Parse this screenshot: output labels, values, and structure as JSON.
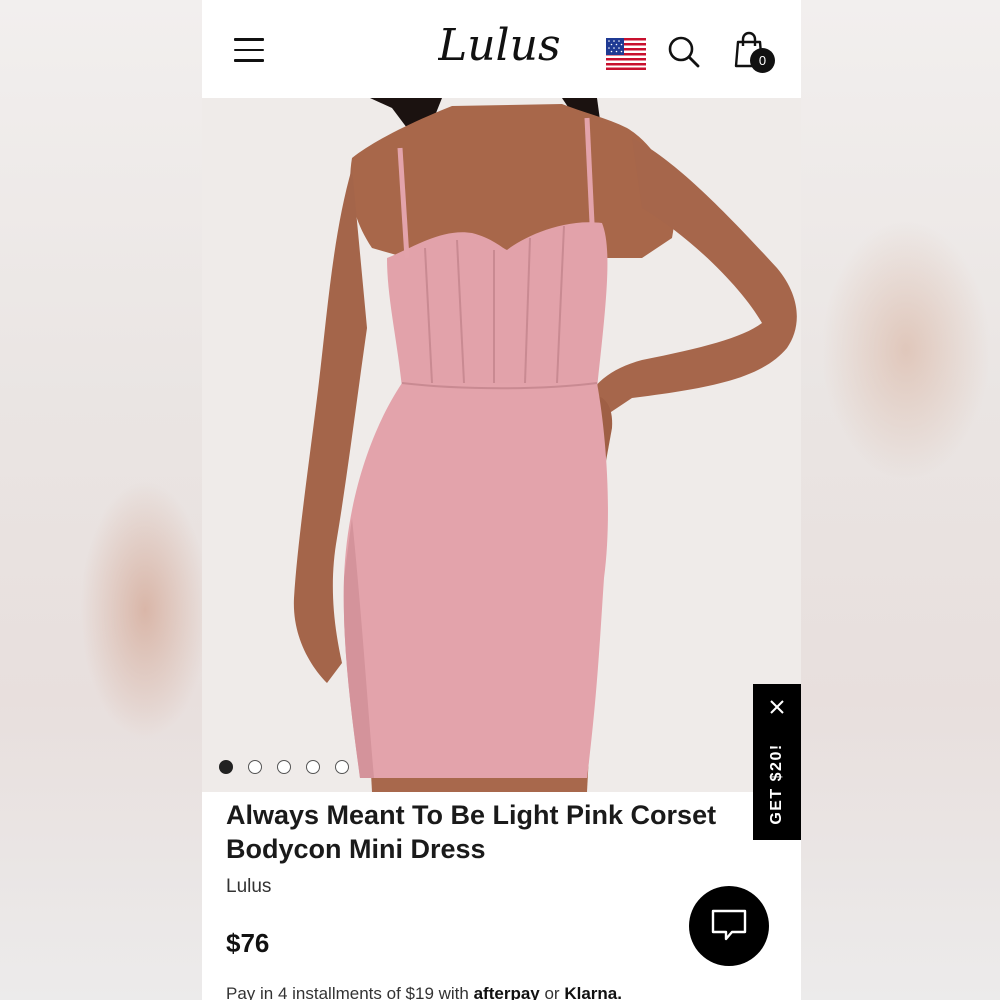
{
  "header": {
    "logo_text": "Lulus",
    "bag_count": "0",
    "icons": [
      "menu-icon",
      "us-flag-icon",
      "search-icon",
      "shopping-bag-icon"
    ]
  },
  "gallery": {
    "image_alt": "Woman wearing a light pink corset bodycon mini dress",
    "slide_count": 5,
    "active_slide": 1
  },
  "promo": {
    "label": "GET $20!"
  },
  "product": {
    "title": "Always Meant To Be Light Pink Corset Bodycon Mini Dress",
    "brand": "Lulus",
    "price": "$76",
    "installments_text": "Pay in 4 installments of $19 with",
    "afterpay_label": "afterpay",
    "or_text": "or",
    "klarna_label": "Klarna."
  },
  "colors": {
    "accent": "#000000",
    "dress_pink": "#e3a3ab",
    "background": "#ffffff"
  }
}
